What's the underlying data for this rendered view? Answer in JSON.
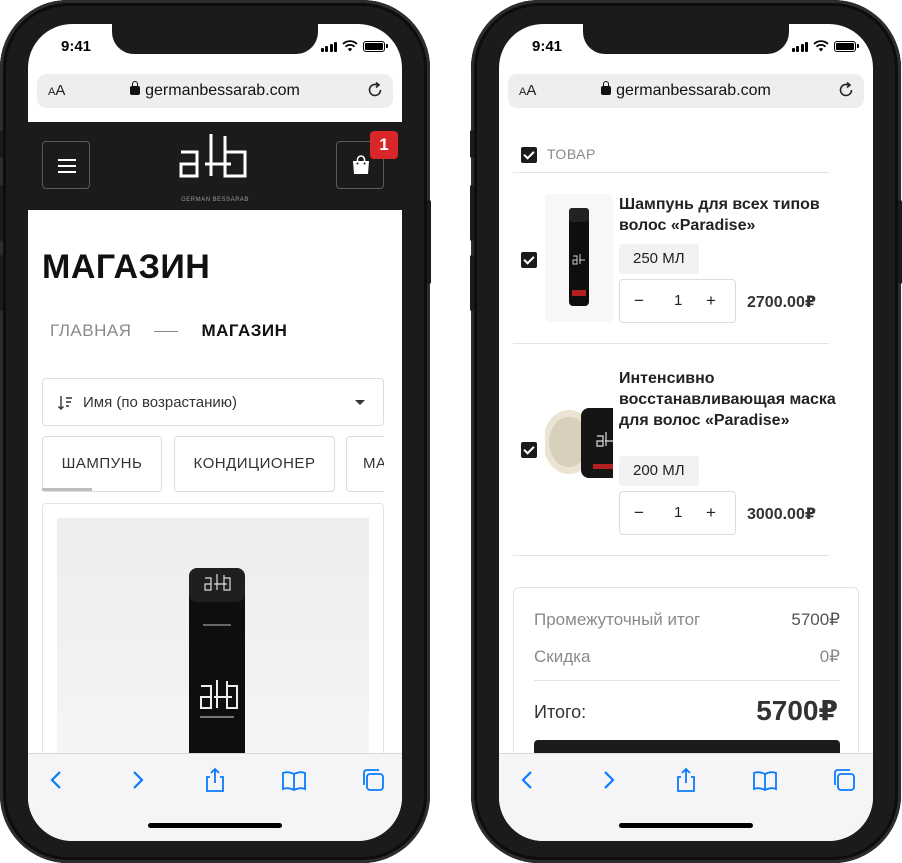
{
  "status_bar": {
    "time": "9:41"
  },
  "browser": {
    "aa_label": "AA",
    "domain": "germanbessarab.com"
  },
  "shop_page": {
    "logo_subtitle": "GERMAN BESSARAB",
    "cart_count": "1",
    "title": "МАГАЗИН",
    "breadcrumb": {
      "home": "ГЛАВНАЯ",
      "current": "МАГАЗИН"
    },
    "sort": {
      "selected": "Имя (по возрастанию)"
    },
    "tabs": [
      {
        "label": "ШАМПУНЬ",
        "active": true
      },
      {
        "label": "КОНДИЦИОНЕР",
        "active": false
      },
      {
        "label": "МА",
        "active": false
      }
    ]
  },
  "cart_page": {
    "column_label": "ТОВАР",
    "items": [
      {
        "name": "Шампунь для всех типов волос «Paradise»",
        "volume": "250 МЛ",
        "quantity": "1",
        "price": "2700.00₽",
        "checked": true
      },
      {
        "name": "Интенсивно восстанавливающая маска для волос «Paradise»",
        "volume": "200 МЛ",
        "quantity": "1",
        "price": "3000.00₽",
        "checked": true
      }
    ],
    "summary": {
      "subtotal_label": "Промежуточный итог",
      "subtotal_value": "5700₽",
      "discount_label": "Скидка",
      "discount_value": "0₽",
      "total_label": "Итого:",
      "total_value": "5700₽"
    }
  },
  "icons": {
    "qty_minus": "−",
    "qty_plus": "+"
  },
  "colors": {
    "header_bg": "#1b1b1b",
    "badge_red": "#d8262b",
    "safari_blue": "#0a7aff"
  }
}
